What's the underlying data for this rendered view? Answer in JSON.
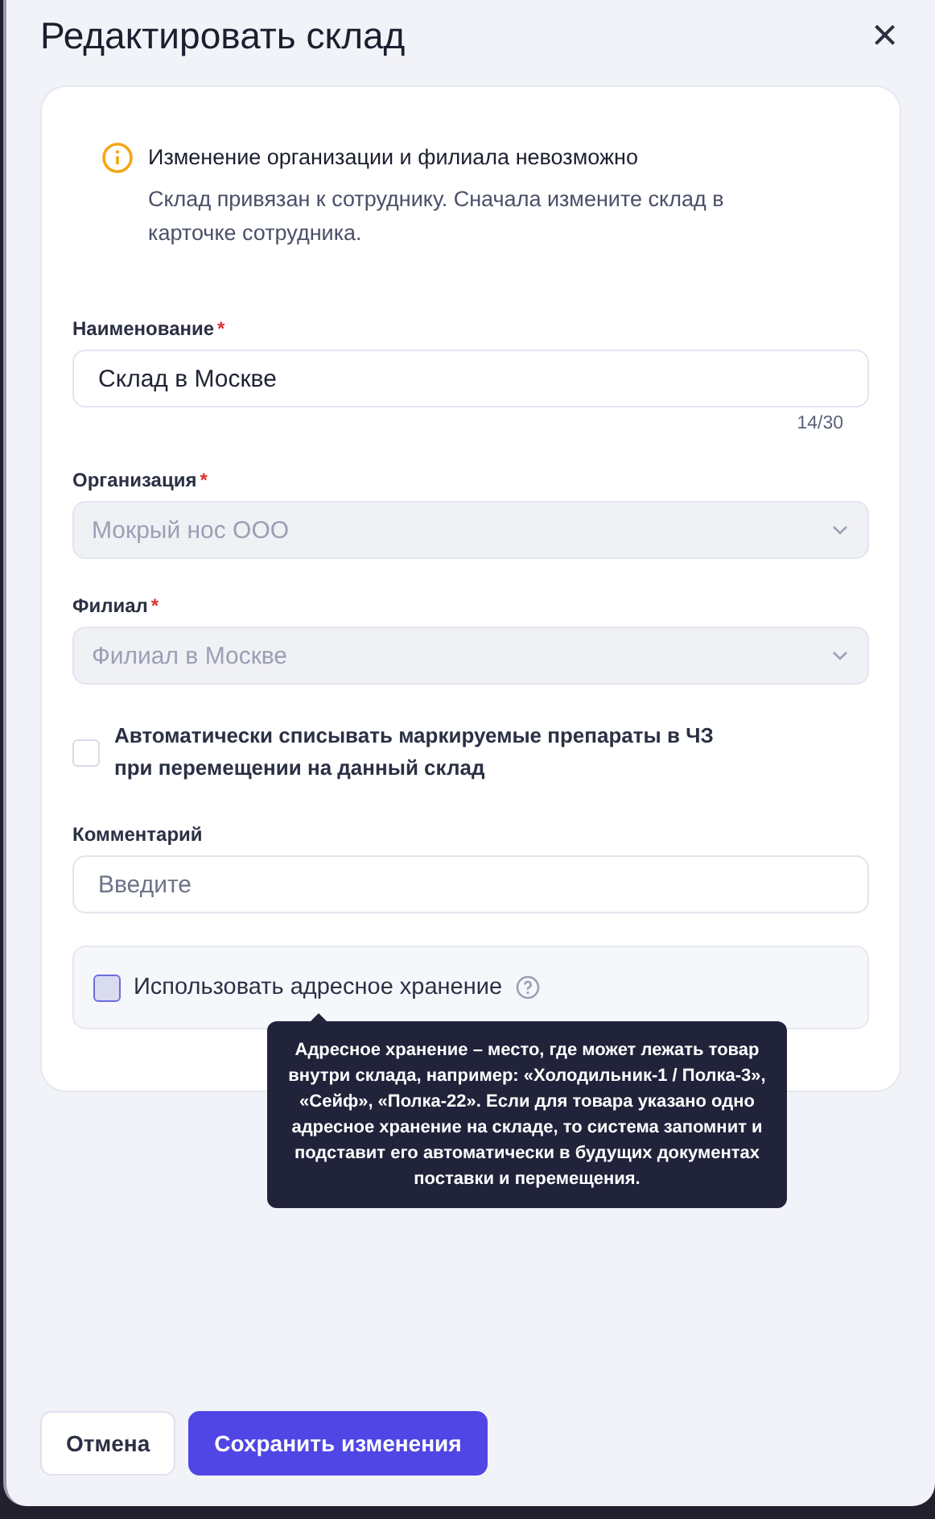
{
  "dialog": {
    "title": "Редактировать склад",
    "close": "×"
  },
  "notice": {
    "title": "Изменение организации и филиала невозможно",
    "text": "Склад привязан к сотруднику. Сначала измените склад в карточке сотрудника."
  },
  "fields": [
    {
      "kind": "text",
      "label": "Наименование",
      "required_mark": "*",
      "value": "Склад в Москве",
      "counter": "14/30"
    },
    {
      "kind": "select",
      "label": "Организация",
      "required_mark": "*",
      "value": "Мокрый нос ООО",
      "disabled": true
    },
    {
      "kind": "select",
      "label": "Филиал",
      "required_mark": "*",
      "value": "Филиал в Москве",
      "disabled": true
    },
    {
      "kind": "checkbox",
      "label": "Автоматически списывать маркируемые препараты в ЧЗ\n при перемещении на данный склад",
      "checked": false,
      "hovered": false
    },
    {
      "kind": "text",
      "label": "Комментарий",
      "placeholder": "Введите"
    },
    {
      "kind": "option",
      "label": "Использовать адресное хранение",
      "checked": false,
      "hovered": true,
      "tooltip": "Адресное хранение – место, где может лежать товар внутри склада, например: «Холодильник-1 / Полка-3», «Сейф», «Полка-22». Если для товара указано одно адресное хранение на складе, то система запомнит и подставит его автоматически в будущих документах поставки и перемещения."
    }
  ],
  "buttons": [
    {
      "label": "Отмена",
      "kind": "secondary"
    },
    {
      "label": "Сохранить изменения",
      "kind": "primary"
    }
  ]
}
